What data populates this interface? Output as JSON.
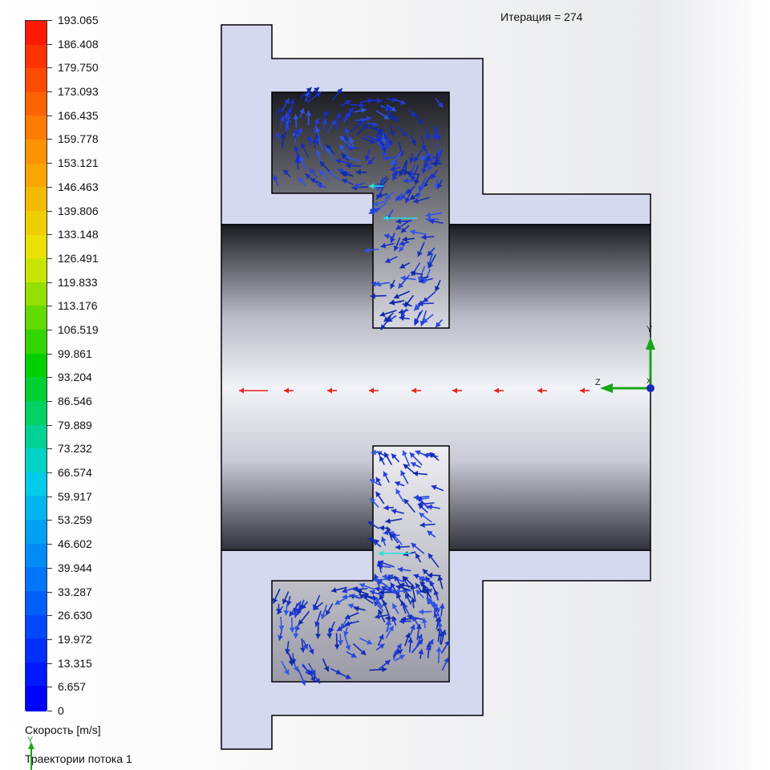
{
  "header": {
    "iteration_label": "Итерация = 274"
  },
  "legend": {
    "title": "Скорость [m/s]",
    "ticks": [
      "193.065",
      "186.408",
      "179.750",
      "173.093",
      "166.435",
      "159.778",
      "153.121",
      "146.463",
      "139.806",
      "133.148",
      "126.491",
      "119.833",
      "113.176",
      "106.519",
      "99.861",
      "93.204",
      "86.546",
      "79.889",
      "73.232",
      "66.574",
      "59.917",
      "53.259",
      "46.602",
      "39.944",
      "33.287",
      "26.630",
      "19.972",
      "13.315",
      "6.657",
      "0"
    ]
  },
  "footer": {
    "trajectories_label": "Траектории потока 1"
  },
  "axes_triad": {
    "y_label": "Y",
    "z_label": "Z",
    "x_label": "X"
  },
  "bottom_triad": {
    "y_label": "Y"
  },
  "colors": {
    "solid_fill": "#d5d9f0",
    "outline": "#000000",
    "arrow_dense": "#1a2fcf",
    "arrow_bright": "#22e0e0",
    "arrow_center": "#e8241a",
    "axis_green": "#1aa51a",
    "axis_blue": "#1a2ab8"
  }
}
